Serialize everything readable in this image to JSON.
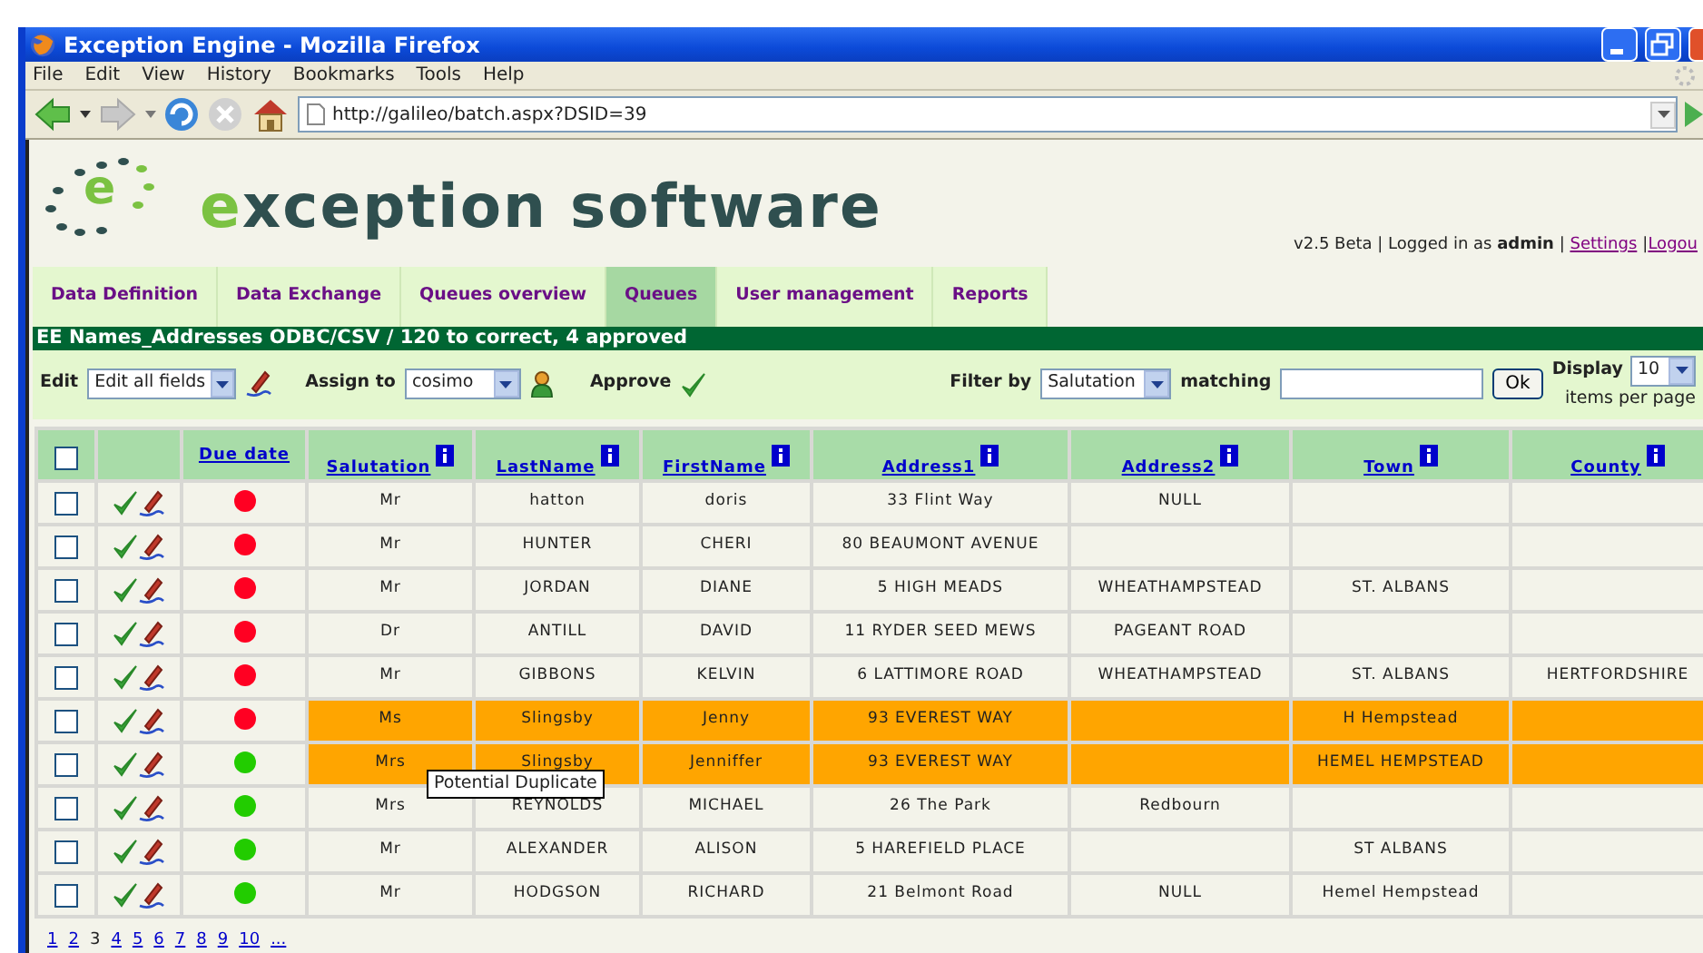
{
  "window": {
    "title": "Exception Engine - Mozilla Firefox"
  },
  "menu": [
    "File",
    "Edit",
    "View",
    "History",
    "Bookmarks",
    "Tools",
    "Help"
  ],
  "address_bar": {
    "url": "http://galileo/batch.aspx?DSID=39"
  },
  "header": {
    "logo_letter": "e",
    "brand": "exception software",
    "status": "v2.5 Beta | Logged in as **admin** |",
    "links": [
      "Settings",
      "Logou"
    ],
    "separator": "|"
  },
  "tabs": [
    {
      "label": "Data Definition",
      "selected": false
    },
    {
      "label": "Data Exchange",
      "selected": false
    },
    {
      "label": "Queues overview",
      "selected": false
    },
    {
      "label": "Queues",
      "selected": true
    },
    {
      "label": "User management",
      "selected": false
    },
    {
      "label": "Reports",
      "selected": false
    }
  ],
  "queue_title": "EE Names_Addresses ODBC/CSV / 120 to correct, 4 approved",
  "toolbar": {
    "edit_label": "Edit",
    "edit_value": "Edit all fields",
    "assign_label": "Assign to",
    "assign_value": "cosimo",
    "approve_label": "Approve",
    "filter_label": "Filter by",
    "filter_value": "Salutation",
    "matching_label": "matching",
    "ok_button": "Ok",
    "display_label": "Display",
    "display_value": "10",
    "per_page_label": "items per page"
  },
  "table": {
    "select_all": {
      "checked": false
    },
    "columns": [
      {
        "label": "Due date",
        "info": false
      },
      {
        "label": "Salutation",
        "info": true
      },
      {
        "label": "LastName",
        "info": true
      },
      {
        "label": "FirstName",
        "info": true
      },
      {
        "label": "Address1",
        "info": true
      },
      {
        "label": "Address2",
        "info": true
      },
      {
        "label": "Town",
        "info": true
      },
      {
        "label": "County",
        "info": true
      }
    ],
    "rows": [
      {
        "checked": false,
        "color": "#ff0022",
        "highlight": false,
        "cells": [
          "",
          "Mr",
          "hatton",
          "doris",
          "33 Flint Way",
          "NULL",
          "",
          ""
        ]
      },
      {
        "checked": false,
        "color": "#ff0022",
        "highlight": false,
        "cells": [
          "",
          "Mr",
          "HUNTER",
          "CHERI",
          "80 BEAUMONT AVENUE",
          "",
          "",
          ""
        ]
      },
      {
        "checked": false,
        "color": "#ff0022",
        "highlight": false,
        "cells": [
          "",
          "Mr",
          "JORDAN",
          "DIANE",
          "5 HIGH MEADS",
          "WHEATHAMPSTEAD",
          "ST. ALBANS",
          ""
        ]
      },
      {
        "checked": false,
        "color": "#ff0022",
        "highlight": false,
        "cells": [
          "",
          "Dr",
          "ANTILL",
          "DAVID",
          "11 RYDER SEED MEWS",
          "PAGEANT ROAD",
          "",
          ""
        ]
      },
      {
        "checked": false,
        "color": "#ff0022",
        "highlight": false,
        "cells": [
          "",
          "Mr",
          "GIBBONS",
          "KELVIN",
          "6 LATTIMORE ROAD",
          "WHEATHAMPSTEAD",
          "ST. ALBANS",
          "HERTFORDSHIRE"
        ]
      },
      {
        "checked": false,
        "color": "#ff0022",
        "highlight": true,
        "cells": [
          "",
          "Ms",
          "Slingsby",
          "Jenny",
          "93 EVEREST WAY",
          "",
          "H Hempstead",
          ""
        ]
      },
      {
        "checked": false,
        "color": "#22cc00",
        "highlight": true,
        "tooltip": "Potential Duplicate",
        "cells": [
          "",
          "Mrs",
          "Slingsby",
          "Jenniffer",
          "93 EVEREST WAY",
          "",
          "HEMEL HEMPSTEAD",
          ""
        ]
      },
      {
        "checked": false,
        "color": "#22cc00",
        "highlight": false,
        "cells": [
          "",
          "Mrs",
          "REYNOLDS",
          "MICHAEL",
          "26 The Park",
          "Redbourn",
          "",
          ""
        ]
      },
      {
        "checked": false,
        "color": "#22cc00",
        "highlight": false,
        "cells": [
          "",
          "Mr",
          "ALEXANDER",
          "ALISON",
          "5 HAREFIELD PLACE",
          "",
          "ST ALBANS",
          ""
        ]
      },
      {
        "checked": false,
        "color": "#22cc00",
        "highlight": false,
        "cells": [
          "",
          "Mr",
          "HODGSON",
          "RICHARD",
          "21 Belmont Road",
          "NULL",
          "Hemel Hempstead",
          ""
        ]
      }
    ]
  },
  "pagination": [
    {
      "label": "1",
      "selected": false
    },
    {
      "label": "2",
      "selected": false
    },
    {
      "label": "3",
      "selected": true
    },
    {
      "label": "4",
      "selected": false
    },
    {
      "label": "5",
      "selected": false
    },
    {
      "label": "6",
      "selected": false
    },
    {
      "label": "7",
      "selected": false
    },
    {
      "label": "8",
      "selected": false
    },
    {
      "label": "9",
      "selected": false
    },
    {
      "label": "10",
      "selected": false
    },
    {
      "label": "...",
      "selected": false
    }
  ]
}
